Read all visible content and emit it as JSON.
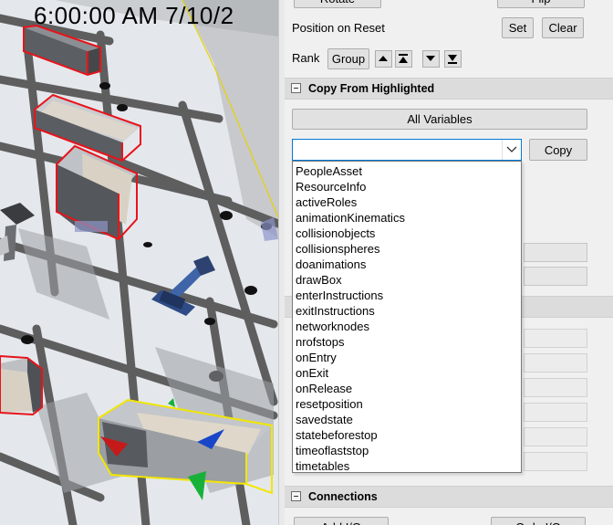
{
  "viewport": {
    "clock_text": "6:00:00 AM  7/10/2"
  },
  "panel": {
    "rotate_label": "Rotate",
    "flip_label": "Flip",
    "position_on_reset_label": "Position on Reset",
    "set_label": "Set",
    "clear_label": "Clear",
    "rank_label": "Rank",
    "group_label": "Group",
    "copy_section_title": "Copy From Highlighted",
    "all_variables_label": "All Variables",
    "copy_label": "Copy",
    "combo_value": "",
    "connections_section_title": "Connections",
    "add_io_label": "Add I/O",
    "open_io_label": "Ordo I/O"
  },
  "dropdown": {
    "items": [
      "PeopleAsset",
      "ResourceInfo",
      "activeRoles",
      "animationKinematics",
      "collisionobjects",
      "collisionspheres",
      "doanimations",
      "drawBox",
      "enterInstructions",
      "exitInstructions",
      "networknodes",
      "nrofstops",
      "onEntry",
      "onExit",
      "onRelease",
      "resetposition",
      "savedstate",
      "statebeforestop",
      "timeoflaststop",
      "timetables"
    ]
  },
  "colors": {
    "selection_red": "#e8131b",
    "selection_yellow": "#f2e600",
    "combo_focus": "#0078d7",
    "floor": "#e6eaee",
    "path": "#5f5f5f"
  },
  "icons": [
    "chevron-down-icon",
    "move-up-icon",
    "move-top-icon",
    "move-down-icon",
    "move-bottom-icon",
    "collapse-icon"
  ]
}
